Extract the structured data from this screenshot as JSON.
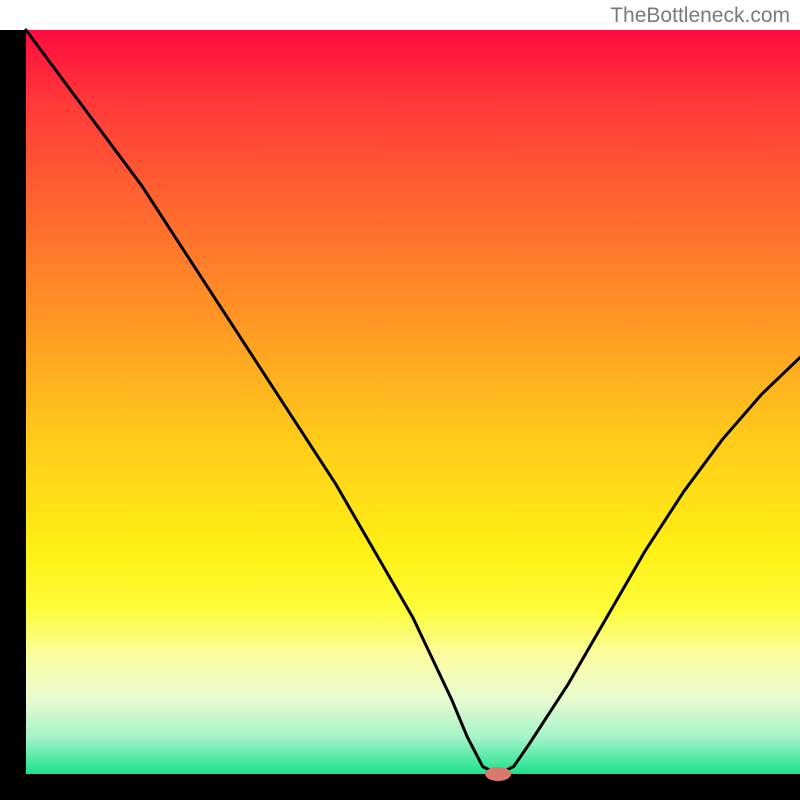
{
  "watermark": "TheBottleneck.com",
  "chart_data": {
    "type": "line",
    "title": "",
    "xlabel": "",
    "ylabel": "",
    "xlim": [
      0,
      100
    ],
    "ylim": [
      0,
      100
    ],
    "series": [
      {
        "name": "curve",
        "x": [
          0,
          5,
          10,
          15,
          20,
          25,
          30,
          35,
          40,
          45,
          50,
          55,
          57,
          59,
          61,
          63,
          65,
          70,
          75,
          80,
          85,
          90,
          95,
          100
        ],
        "y": [
          100,
          93,
          86,
          79,
          71,
          63,
          55,
          47,
          39,
          30,
          21,
          10,
          5,
          1,
          0,
          1,
          4,
          12,
          21,
          30,
          38,
          45,
          51,
          56
        ]
      }
    ],
    "markers": [
      {
        "name": "minimum-marker",
        "x": 61,
        "y": 0,
        "color": "#d9786c",
        "rx": 13,
        "ry": 7
      }
    ],
    "gradient_bands": [
      {
        "offset": 0.0,
        "color": "#ff0c3e"
      },
      {
        "offset": 0.1,
        "color": "#ff3a3a"
      },
      {
        "offset": 0.25,
        "color": "#ff6a2f"
      },
      {
        "offset": 0.4,
        "color": "#ff9a24"
      },
      {
        "offset": 0.55,
        "color": "#ffcb1a"
      },
      {
        "offset": 0.7,
        "color": "#fff014"
      },
      {
        "offset": 0.78,
        "color": "#fdfd3b"
      },
      {
        "offset": 0.84,
        "color": "#fbfca0"
      },
      {
        "offset": 0.9,
        "color": "#e7fad0"
      },
      {
        "offset": 0.95,
        "color": "#a5f3c8"
      },
      {
        "offset": 1.0,
        "color": "#19e28a"
      }
    ],
    "axis_stroke": "#000000",
    "axis_width": 26,
    "curve_stroke": "#000000",
    "curve_width": 3
  }
}
